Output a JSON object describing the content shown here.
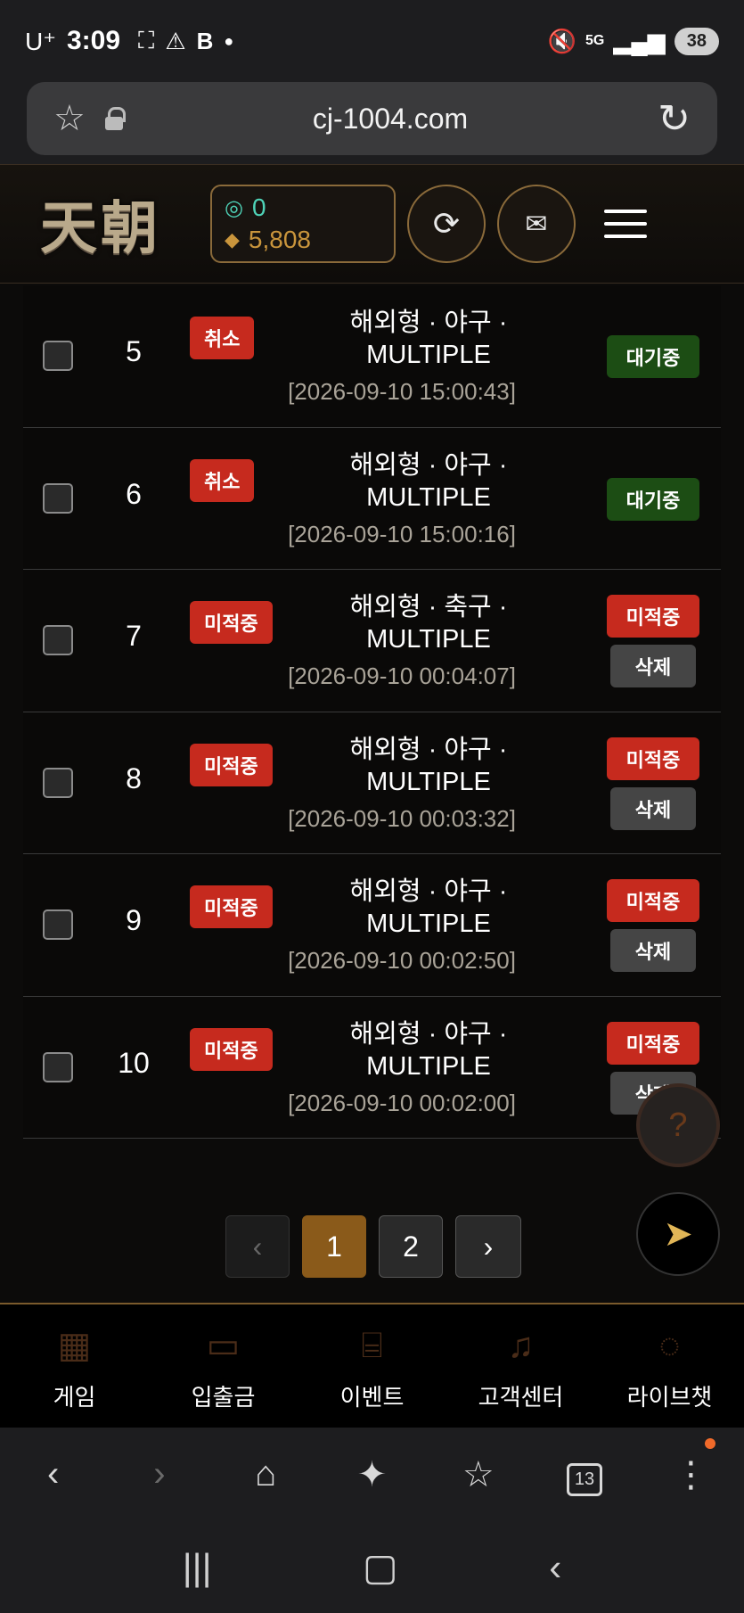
{
  "status_bar": {
    "carrier": "U⁺",
    "time": "3:09",
    "left_icons": [
      "screenshot-icon",
      "warning-icon",
      "b-icon",
      "dot-icon"
    ],
    "network": "5G",
    "battery": "38"
  },
  "browser": {
    "url": "cj-1004.com"
  },
  "header": {
    "logo": "天朝",
    "coin_balance": "0",
    "gem_balance": "5,808"
  },
  "rows": [
    {
      "num": "5",
      "tag": "취소",
      "title_line1": "해외형 · 야구 ·",
      "title_line2": "MULTIPLE",
      "date": "[2026-09-10 15:00:43]",
      "status": "대기중",
      "status_color": "#1c4d14",
      "delete": null
    },
    {
      "num": "6",
      "tag": "취소",
      "title_line1": "해외형 · 야구 ·",
      "title_line2": "MULTIPLE",
      "date": "[2026-09-10 15:00:16]",
      "status": "대기중",
      "status_color": "#1c4d14",
      "delete": null
    },
    {
      "num": "7",
      "tag": "미적중",
      "title_line1": "해외형 · 축구 ·",
      "title_line2": "MULTIPLE",
      "date": "[2026-09-10 00:04:07]",
      "status": "미적중",
      "status_color": "#c62a1e",
      "delete": "삭제"
    },
    {
      "num": "8",
      "tag": "미적중",
      "title_line1": "해외형 · 야구 ·",
      "title_line2": "MULTIPLE",
      "date": "[2026-09-10 00:03:32]",
      "status": "미적중",
      "status_color": "#c62a1e",
      "delete": "삭제"
    },
    {
      "num": "9",
      "tag": "미적중",
      "title_line1": "해외형 · 야구 ·",
      "title_line2": "MULTIPLE",
      "date": "[2026-09-10 00:02:50]",
      "status": "미적중",
      "status_color": "#c62a1e",
      "delete": "삭제"
    },
    {
      "num": "10",
      "tag": "미적중",
      "title_line1": "해외형 · 야구 ·",
      "title_line2": "MULTIPLE",
      "date": "[2026-09-10 00:02:00]",
      "status": "미적중",
      "status_color": "#c62a1e",
      "delete": "삭제"
    }
  ],
  "pagination": {
    "pages": [
      "1",
      "2"
    ],
    "current": "1"
  },
  "bottom_nav": [
    {
      "label": "게임",
      "icon": "grid-icon"
    },
    {
      "label": "입출금",
      "icon": "wallet-icon"
    },
    {
      "label": "이벤트",
      "icon": "gift-icon"
    },
    {
      "label": "고객센터",
      "icon": "headset-icon"
    },
    {
      "label": "라이브챗",
      "icon": "chat-icon"
    }
  ],
  "browser_toolbar": {
    "tab_count": "13"
  },
  "colors": {
    "accent_gold": "#8a6a3a",
    "wait_green": "#1c4d14",
    "miss_red": "#c62a1e"
  }
}
